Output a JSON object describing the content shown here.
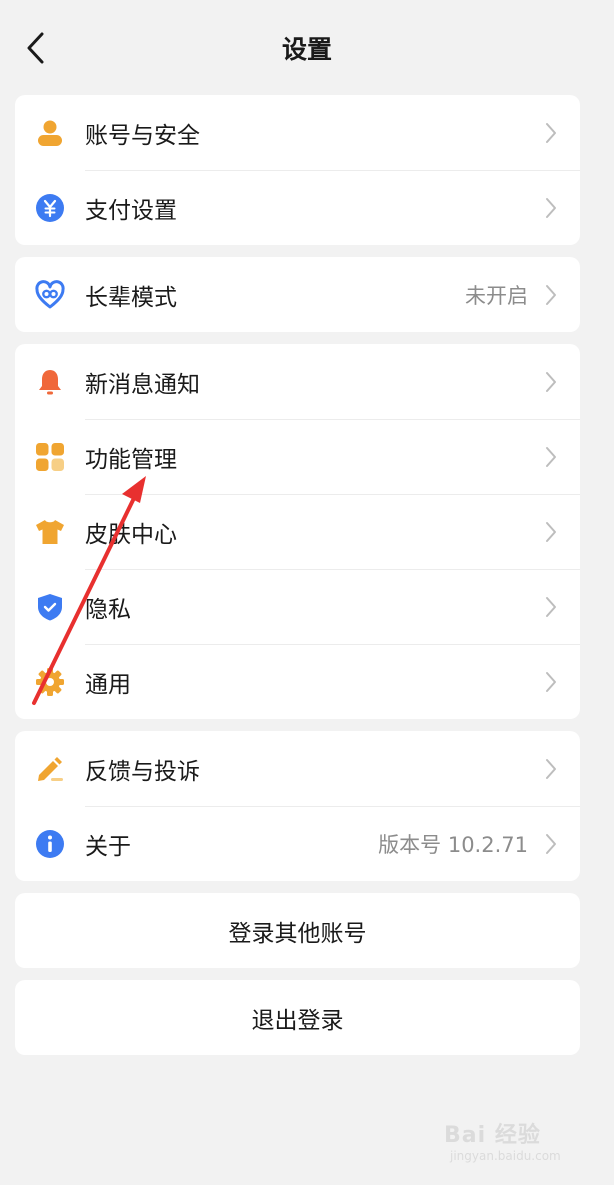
{
  "header": {
    "title": "设置",
    "back_icon": "chevron-left-icon"
  },
  "groups": {
    "account": [
      {
        "label": "账号与安全",
        "icon": "user-icon",
        "color": "#f0a531"
      },
      {
        "label": "支付设置",
        "icon": "yuan-icon",
        "color": "#3d7bf2"
      }
    ],
    "elder": [
      {
        "label": "长辈模式",
        "icon": "heart-link-icon",
        "color": "#3d7bf2",
        "value": "未开启"
      }
    ],
    "features": [
      {
        "label": "新消息通知",
        "icon": "bell-icon",
        "color": "#f0683a"
      },
      {
        "label": "功能管理",
        "icon": "grid-icon",
        "color": "#f0a531"
      },
      {
        "label": "皮肤中心",
        "icon": "tshirt-icon",
        "color": "#f0a531"
      },
      {
        "label": "隐私",
        "icon": "shield-icon",
        "color": "#3d7bf2"
      },
      {
        "label": "通用",
        "icon": "gear-icon",
        "color": "#f0a531"
      }
    ],
    "support": [
      {
        "label": "反馈与投诉",
        "icon": "pencil-icon",
        "color": "#f0a531"
      },
      {
        "label": "关于",
        "icon": "info-icon",
        "color": "#3d7bf2",
        "value": "版本号 10.2.71"
      }
    ]
  },
  "buttons": {
    "switch_account": "登录其他账号",
    "logout": "退出登录"
  },
  "colors": {
    "background": "#f2f2f2",
    "card": "#ffffff",
    "annotation_arrow": "#e8302f",
    "chevron": "#bdbdbd"
  },
  "watermark": {
    "logo": "Bai 经验",
    "sub": "jingyan.baidu.com"
  }
}
